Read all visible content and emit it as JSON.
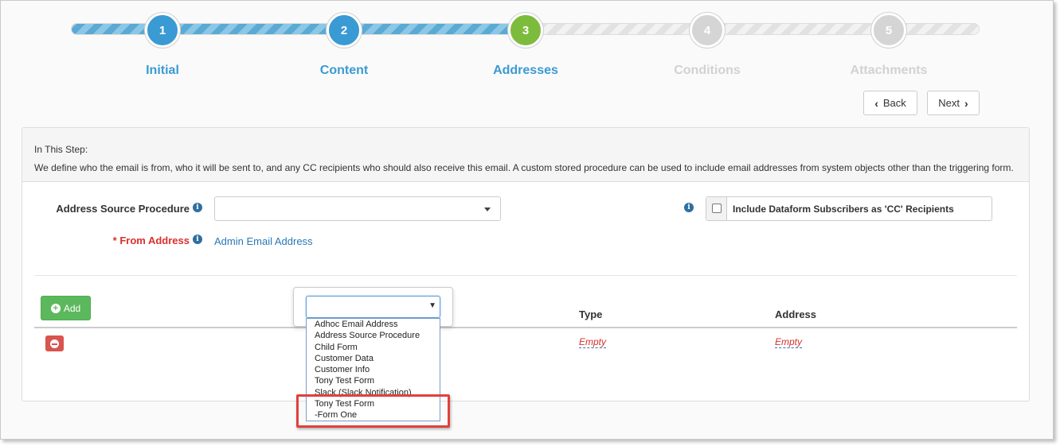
{
  "wizard": {
    "steps": [
      {
        "number": "1",
        "label": "Initial",
        "state": "done"
      },
      {
        "number": "2",
        "label": "Content",
        "state": "done"
      },
      {
        "number": "3",
        "label": "Addresses",
        "state": "active"
      },
      {
        "number": "4",
        "label": "Conditions",
        "state": "todo"
      },
      {
        "number": "5",
        "label": "Attachments",
        "state": "todo"
      }
    ],
    "back_label": "Back",
    "next_label": "Next"
  },
  "panel": {
    "heading": "In This Step:",
    "description": "We define who the email is from, who it will be sent to, and any CC recipients who should also receive this email. A custom stored procedure can be used to include email addresses from system objects other than the triggering form."
  },
  "form": {
    "address_source_label": "Address Source Procedure",
    "address_source_value": "",
    "from_address_label": "* From Address",
    "from_address_value": "Admin Email Address",
    "cc_label": "Include Dataform Subscribers as 'CC' Recipients",
    "cc_checked": false
  },
  "table": {
    "add_label": "Add",
    "columns": [
      "Type",
      "Address"
    ],
    "rows": [
      {
        "type": "Empty",
        "address": "Empty"
      }
    ]
  },
  "dropdown": {
    "selected": "",
    "options": [
      "Adhoc Email Address",
      "Address Source Procedure",
      "Child Form",
      "Customer Data",
      "Customer Info",
      "Tony Test Form",
      "Slack (Slack Notification)",
      "Tony Test Form",
      "-Form One"
    ]
  },
  "colors": {
    "step_done": "#3a9ad3",
    "step_active": "#7dbb3c",
    "step_todo": "#d5d5d5",
    "add_button": "#5cb85c",
    "remove_button": "#d9534f",
    "required": "#d9302c",
    "link": "#2a78b5",
    "highlight_box": "#e0413c"
  }
}
